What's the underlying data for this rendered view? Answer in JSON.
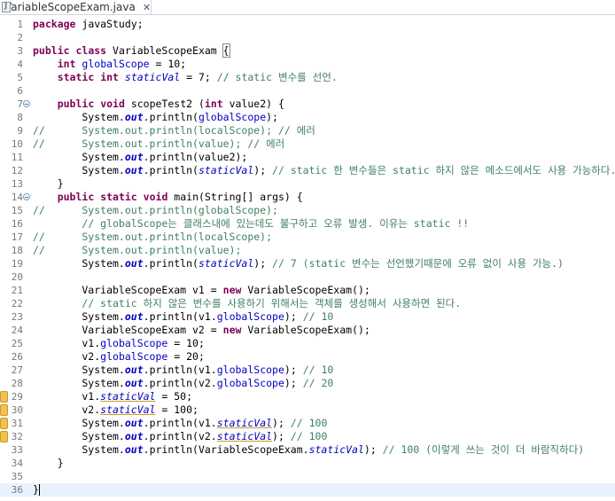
{
  "tab": {
    "title": "VariableScopeExam.java",
    "close_glyph": "✕"
  },
  "lines": [
    {
      "n": "1",
      "fold": false,
      "warn": false,
      "tokens": [
        {
          "t": "kw",
          "v": "package"
        },
        {
          "t": "pl",
          "v": " javaStudy;"
        }
      ]
    },
    {
      "n": "2",
      "fold": false,
      "warn": false,
      "tokens": []
    },
    {
      "n": "3",
      "fold": false,
      "warn": false,
      "tokens": [
        {
          "t": "kw",
          "v": "public"
        },
        {
          "t": "pl",
          "v": " "
        },
        {
          "t": "kw",
          "v": "class"
        },
        {
          "t": "pl",
          "v": " VariableScopeExam "
        },
        {
          "t": "hl",
          "v": "{"
        }
      ]
    },
    {
      "n": "4",
      "fold": false,
      "warn": false,
      "tokens": [
        {
          "t": "pl",
          "v": "    "
        },
        {
          "t": "kw",
          "v": "int"
        },
        {
          "t": "pl",
          "v": " "
        },
        {
          "t": "fld",
          "v": "globalScope"
        },
        {
          "t": "pl",
          "v": " = 10;"
        }
      ]
    },
    {
      "n": "5",
      "fold": false,
      "warn": false,
      "tokens": [
        {
          "t": "pl",
          "v": "    "
        },
        {
          "t": "kw",
          "v": "static"
        },
        {
          "t": "pl",
          "v": " "
        },
        {
          "t": "kw",
          "v": "int"
        },
        {
          "t": "pl",
          "v": " "
        },
        {
          "t": "sfld",
          "v": "staticVal"
        },
        {
          "t": "pl",
          "v": " = 7; "
        },
        {
          "t": "cm",
          "v": "// static 변수를 선언."
        }
      ]
    },
    {
      "n": "6",
      "fold": false,
      "warn": false,
      "tokens": []
    },
    {
      "n": "7",
      "fold": true,
      "warn": false,
      "tokens": [
        {
          "t": "pl",
          "v": "    "
        },
        {
          "t": "kw",
          "v": "public"
        },
        {
          "t": "pl",
          "v": " "
        },
        {
          "t": "kw",
          "v": "void"
        },
        {
          "t": "pl",
          "v": " scopeTest2 ("
        },
        {
          "t": "kw",
          "v": "int"
        },
        {
          "t": "pl",
          "v": " value2) {"
        }
      ]
    },
    {
      "n": "8",
      "fold": false,
      "warn": false,
      "tokens": [
        {
          "t": "pl",
          "v": "        System."
        },
        {
          "t": "out",
          "v": "out"
        },
        {
          "t": "pl",
          "v": ".println("
        },
        {
          "t": "fld",
          "v": "globalScope"
        },
        {
          "t": "pl",
          "v": ");"
        }
      ]
    },
    {
      "n": "9",
      "fold": false,
      "warn": false,
      "tokens": [
        {
          "t": "cm",
          "v": "//      System.out.println(localScope); // 에러"
        }
      ]
    },
    {
      "n": "10",
      "fold": false,
      "warn": false,
      "tokens": [
        {
          "t": "cm",
          "v": "//      System.out.println(value); // 에러"
        }
      ]
    },
    {
      "n": "11",
      "fold": false,
      "warn": false,
      "tokens": [
        {
          "t": "pl",
          "v": "        System."
        },
        {
          "t": "out",
          "v": "out"
        },
        {
          "t": "pl",
          "v": ".println(value2);"
        }
      ]
    },
    {
      "n": "12",
      "fold": false,
      "warn": false,
      "tokens": [
        {
          "t": "pl",
          "v": "        System."
        },
        {
          "t": "out",
          "v": "out"
        },
        {
          "t": "pl",
          "v": ".println("
        },
        {
          "t": "sfld",
          "v": "staticVal"
        },
        {
          "t": "pl",
          "v": "); "
        },
        {
          "t": "cm",
          "v": "// static 한 변수들은 static 하지 않은 메소드에서도 사용 가능하다."
        }
      ]
    },
    {
      "n": "13",
      "fold": false,
      "warn": false,
      "tokens": [
        {
          "t": "pl",
          "v": "    }"
        }
      ]
    },
    {
      "n": "14",
      "fold": true,
      "warn": false,
      "tokens": [
        {
          "t": "pl",
          "v": "    "
        },
        {
          "t": "kw",
          "v": "public"
        },
        {
          "t": "pl",
          "v": " "
        },
        {
          "t": "kw",
          "v": "static"
        },
        {
          "t": "pl",
          "v": " "
        },
        {
          "t": "kw",
          "v": "void"
        },
        {
          "t": "pl",
          "v": " main(String[] args) {"
        }
      ]
    },
    {
      "n": "15",
      "fold": false,
      "warn": false,
      "tokens": [
        {
          "t": "cm",
          "v": "//      System.out.println(globalScope);"
        }
      ]
    },
    {
      "n": "16",
      "fold": false,
      "warn": false,
      "tokens": [
        {
          "t": "pl",
          "v": "        "
        },
        {
          "t": "cm",
          "v": "// globalScope는 클래스내에 있는데도 불구하고 오류 발생. 이유는 static !!"
        }
      ]
    },
    {
      "n": "17",
      "fold": false,
      "warn": false,
      "tokens": [
        {
          "t": "cm",
          "v": "//      System.out.println(localScope);"
        }
      ]
    },
    {
      "n": "18",
      "fold": false,
      "warn": false,
      "tokens": [
        {
          "t": "cm",
          "v": "//      System.out.println(value);"
        }
      ]
    },
    {
      "n": "19",
      "fold": false,
      "warn": false,
      "tokens": [
        {
          "t": "pl",
          "v": "        System."
        },
        {
          "t": "out",
          "v": "out"
        },
        {
          "t": "pl",
          "v": ".println("
        },
        {
          "t": "sfld",
          "v": "staticVal"
        },
        {
          "t": "pl",
          "v": "); "
        },
        {
          "t": "cm",
          "v": "// 7 (static 변수는 선언했기때문에 오류 없이 사용 가능.)"
        }
      ]
    },
    {
      "n": "20",
      "fold": false,
      "warn": false,
      "tokens": []
    },
    {
      "n": "21",
      "fold": false,
      "warn": false,
      "tokens": [
        {
          "t": "pl",
          "v": "        VariableScopeExam v1 = "
        },
        {
          "t": "kw",
          "v": "new"
        },
        {
          "t": "pl",
          "v": " VariableScopeExam();"
        }
      ]
    },
    {
      "n": "22",
      "fold": false,
      "warn": false,
      "tokens": [
        {
          "t": "pl",
          "v": "        "
        },
        {
          "t": "cm",
          "v": "// static 하지 않은 변수를 사용하기 위해서는 객체를 생성해서 사용하면 된다."
        }
      ]
    },
    {
      "n": "23",
      "fold": false,
      "warn": false,
      "tokens": [
        {
          "t": "pl",
          "v": "        System."
        },
        {
          "t": "out",
          "v": "out"
        },
        {
          "t": "pl",
          "v": ".println(v1."
        },
        {
          "t": "fld",
          "v": "globalScope"
        },
        {
          "t": "pl",
          "v": "); "
        },
        {
          "t": "cm",
          "v": "// 10"
        }
      ]
    },
    {
      "n": "24",
      "fold": false,
      "warn": false,
      "tokens": [
        {
          "t": "pl",
          "v": "        VariableScopeExam v2 = "
        },
        {
          "t": "kw",
          "v": "new"
        },
        {
          "t": "pl",
          "v": " VariableScopeExam();"
        }
      ]
    },
    {
      "n": "25",
      "fold": false,
      "warn": false,
      "tokens": [
        {
          "t": "pl",
          "v": "        v1."
        },
        {
          "t": "fld",
          "v": "globalScope"
        },
        {
          "t": "pl",
          "v": " = 10;"
        }
      ]
    },
    {
      "n": "26",
      "fold": false,
      "warn": false,
      "tokens": [
        {
          "t": "pl",
          "v": "        v2."
        },
        {
          "t": "fld",
          "v": "globalScope"
        },
        {
          "t": "pl",
          "v": " = 20;"
        }
      ]
    },
    {
      "n": "27",
      "fold": false,
      "warn": false,
      "tokens": [
        {
          "t": "pl",
          "v": "        System."
        },
        {
          "t": "out",
          "v": "out"
        },
        {
          "t": "pl",
          "v": ".println(v1."
        },
        {
          "t": "fld",
          "v": "globalScope"
        },
        {
          "t": "pl",
          "v": "); "
        },
        {
          "t": "cm",
          "v": "// 10"
        }
      ]
    },
    {
      "n": "28",
      "fold": false,
      "warn": false,
      "tokens": [
        {
          "t": "pl",
          "v": "        System."
        },
        {
          "t": "out",
          "v": "out"
        },
        {
          "t": "pl",
          "v": ".println(v2."
        },
        {
          "t": "fld",
          "v": "globalScope"
        },
        {
          "t": "pl",
          "v": "); "
        },
        {
          "t": "cm",
          "v": "// 20"
        }
      ]
    },
    {
      "n": "29",
      "fold": false,
      "warn": true,
      "tokens": [
        {
          "t": "pl",
          "v": "        v1."
        },
        {
          "t": "sfldu",
          "v": "staticVal"
        },
        {
          "t": "pl",
          "v": " = 50;"
        }
      ]
    },
    {
      "n": "30",
      "fold": false,
      "warn": true,
      "tokens": [
        {
          "t": "pl",
          "v": "        v2."
        },
        {
          "t": "sfldu",
          "v": "staticVal"
        },
        {
          "t": "pl",
          "v": " = 100;"
        }
      ]
    },
    {
      "n": "31",
      "fold": false,
      "warn": true,
      "tokens": [
        {
          "t": "pl",
          "v": "        System."
        },
        {
          "t": "out",
          "v": "out"
        },
        {
          "t": "pl",
          "v": ".println(v1."
        },
        {
          "t": "sfldu",
          "v": "staticVal"
        },
        {
          "t": "pl",
          "v": "); "
        },
        {
          "t": "cm",
          "v": "// 100"
        }
      ]
    },
    {
      "n": "32",
      "fold": false,
      "warn": true,
      "tokens": [
        {
          "t": "pl",
          "v": "        System."
        },
        {
          "t": "out",
          "v": "out"
        },
        {
          "t": "pl",
          "v": ".println(v2."
        },
        {
          "t": "sfldu",
          "v": "staticVal"
        },
        {
          "t": "pl",
          "v": "); "
        },
        {
          "t": "cm",
          "v": "// 100"
        }
      ]
    },
    {
      "n": "33",
      "fold": false,
      "warn": false,
      "tokens": [
        {
          "t": "pl",
          "v": "        System."
        },
        {
          "t": "out",
          "v": "out"
        },
        {
          "t": "pl",
          "v": ".println(VariableScopeExam."
        },
        {
          "t": "sfld",
          "v": "staticVal"
        },
        {
          "t": "pl",
          "v": "); "
        },
        {
          "t": "cm",
          "v": "// 100 (이렇게 쓰는 것이 더 바람직하다)"
        }
      ]
    },
    {
      "n": "34",
      "fold": false,
      "warn": false,
      "tokens": [
        {
          "t": "pl",
          "v": "    }"
        }
      ]
    },
    {
      "n": "35",
      "fold": false,
      "warn": false,
      "tokens": []
    },
    {
      "n": "36",
      "fold": false,
      "warn": false,
      "current": true,
      "tokens": [
        {
          "t": "pl",
          "v": "}"
        },
        {
          "t": "caret",
          "v": ""
        }
      ]
    }
  ]
}
